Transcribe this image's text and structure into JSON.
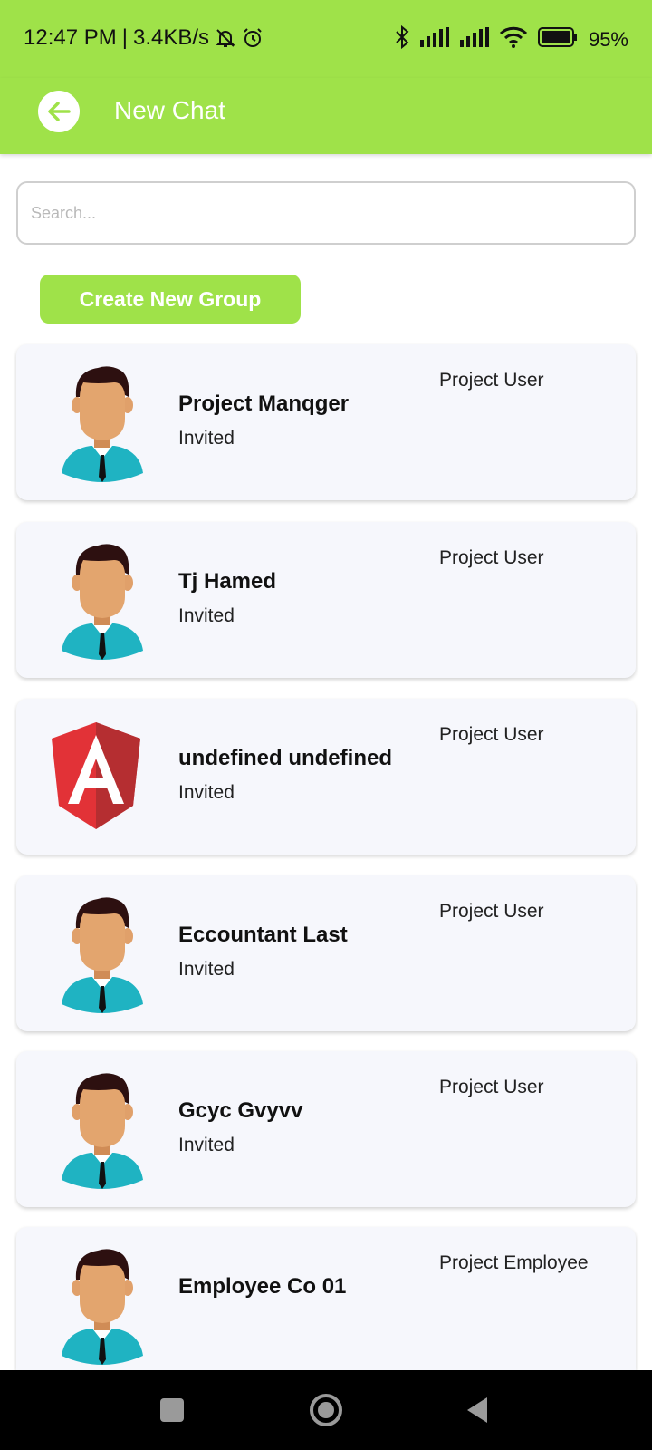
{
  "status_bar": {
    "time": "12:47 PM",
    "separator": "|",
    "speed": "3.4KB/s",
    "battery": "95%",
    "icons": [
      "mute-bell-icon",
      "alarm-icon",
      "bluetooth-icon",
      "signal-icon",
      "signal-icon",
      "wifi-icon",
      "battery-icon"
    ]
  },
  "app_bar": {
    "title": "New Chat",
    "back_icon": "arrow-left-icon"
  },
  "search": {
    "placeholder": "Search...",
    "value": ""
  },
  "create_group_label": "Create New Group",
  "contacts": [
    {
      "name": "Project Manqger",
      "status": "Invited",
      "role": "Project User",
      "avatar": "man-avatar"
    },
    {
      "name": "Tj Hamed",
      "status": "Invited",
      "role": "Project User",
      "avatar": "man-avatar"
    },
    {
      "name": "undefined undefined",
      "status": "Invited",
      "role": "Project User",
      "avatar": "angular-logo"
    },
    {
      "name": "Eccountant Last",
      "status": "Invited",
      "role": "Project User",
      "avatar": "man-avatar"
    },
    {
      "name": "Gcyc Gvyvv",
      "status": "Invited",
      "role": "Project User",
      "avatar": "man-avatar"
    },
    {
      "name": "Employee Co 01",
      "status": "",
      "role": "Project Employee",
      "avatar": "man-avatar"
    }
  ],
  "colors": {
    "accent": "#9fe249",
    "card_bg": "#f6f7fc",
    "nav_bar": "#000000"
  },
  "nav_bar": {
    "buttons": [
      "recents-square-icon",
      "home-circle-icon",
      "back-triangle-icon"
    ]
  }
}
